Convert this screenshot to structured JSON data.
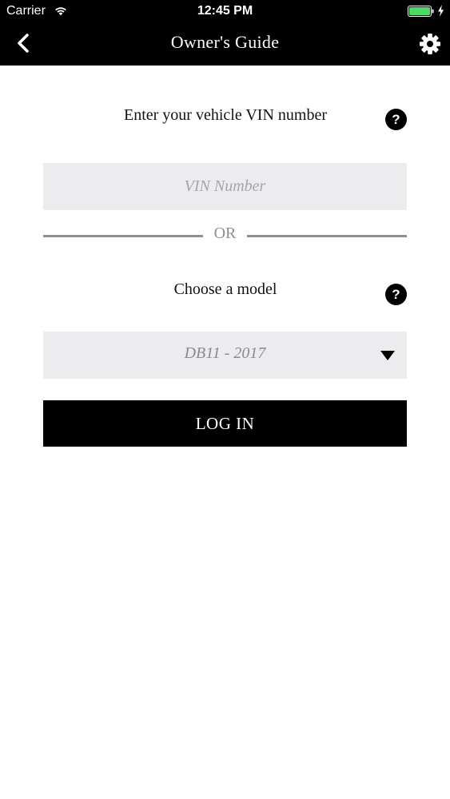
{
  "status_bar": {
    "carrier": "Carrier",
    "time": "12:45 PM",
    "battery_color": "#4cd964",
    "icons": [
      "wifi-icon",
      "battery-icon",
      "charging-icon"
    ]
  },
  "nav": {
    "title": "Owner's Guide",
    "back_icon": "chevron-left-icon",
    "settings_icon": "gear-icon"
  },
  "vin_section": {
    "heading": "Enter your vehicle VIN number",
    "help_label": "?",
    "input_value": "",
    "input_placeholder": "VIN Number"
  },
  "divider": {
    "label": "OR"
  },
  "model_section": {
    "heading": "Choose a model",
    "help_label": "?",
    "selected_value": "DB11 - 2017",
    "dropdown_icon": "triangle-down-icon"
  },
  "login": {
    "label": "LOG IN"
  }
}
